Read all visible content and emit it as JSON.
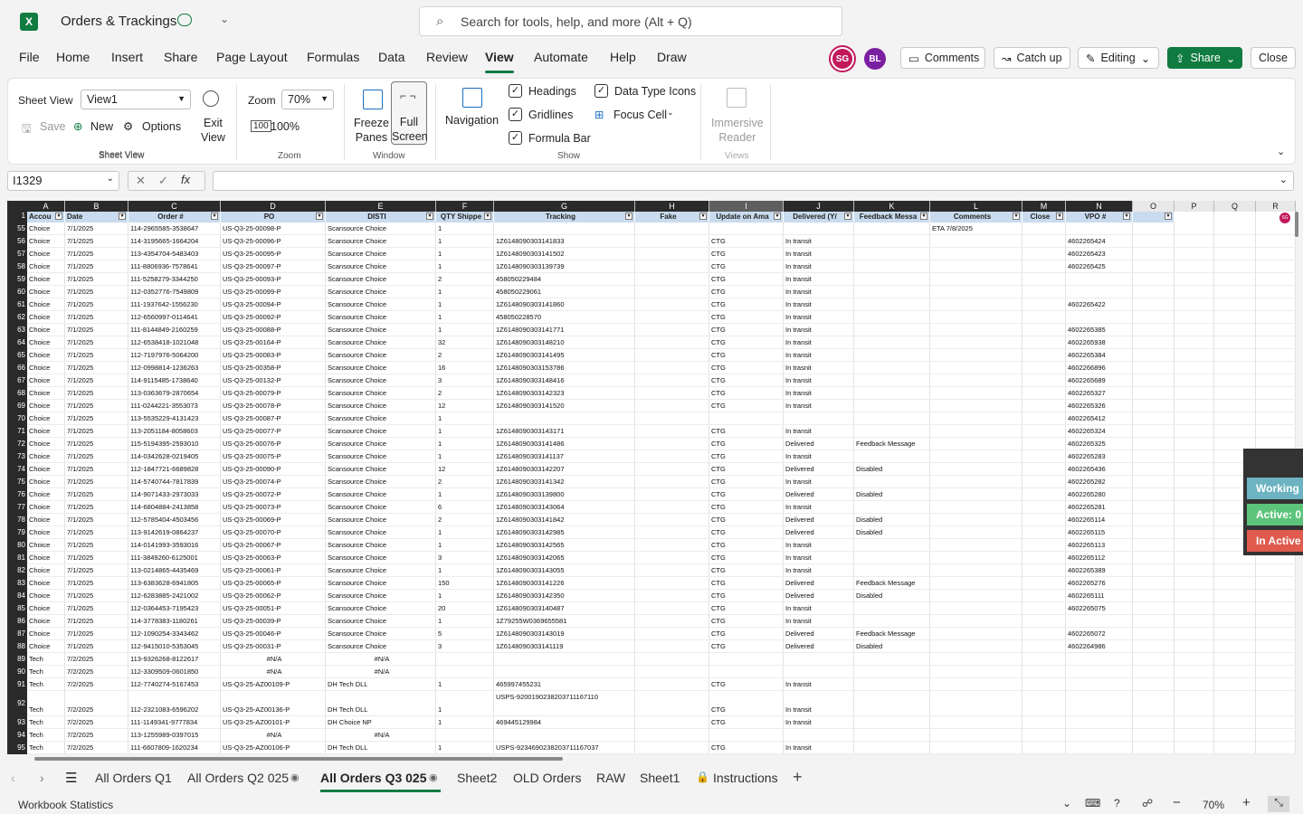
{
  "app": {
    "title": "Orders & Trackings",
    "search_placeholder": "Search for tools, help, and more (Alt + Q)"
  },
  "menu": [
    "File",
    "Home",
    "Insert",
    "Share",
    "Page Layout",
    "Formulas",
    "Data",
    "Review",
    "View",
    "Automate",
    "Help",
    "Draw"
  ],
  "menu_active": "View",
  "avatars": [
    {
      "initials": "SG",
      "color": "#c2185b"
    },
    {
      "initials": "BL",
      "color": "#7b1fa2"
    }
  ],
  "top_buttons": {
    "comments": "Comments",
    "catchup": "Catch up",
    "editing": "Editing",
    "share": "Share",
    "close": "Close"
  },
  "ribbon": {
    "sheet_view_label": "Sheet View",
    "sheet_view_value": "View1",
    "save": "Save",
    "new": "New",
    "options": "Options",
    "exit_view": "Exit\nView",
    "group_sheet_view": "Sheet View",
    "zoom_label": "Zoom",
    "zoom_value": "70%",
    "zoom_100": "100%",
    "group_zoom": "Zoom",
    "freeze": "Freeze\nPanes",
    "full": "Full\nScreen",
    "group_window": "Window",
    "navigation": "Navigation",
    "headings": "Headings",
    "gridlines": "Gridlines",
    "formula_bar": "Formula Bar",
    "data_type_icons": "Data Type Icons",
    "focus_cell": "Focus Cell",
    "group_show": "Show",
    "immersive": "Immersive\nReader",
    "group_views": "Views"
  },
  "formula_bar": {
    "name_box": "I1329",
    "fx": "fx",
    "value": ""
  },
  "columns": [
    {
      "letter": "A",
      "header": "Accou"
    },
    {
      "letter": "B",
      "header": "Date"
    },
    {
      "letter": "C",
      "header": "Order #"
    },
    {
      "letter": "D",
      "header": "PO"
    },
    {
      "letter": "E",
      "header": "DISTI"
    },
    {
      "letter": "F",
      "header": "QTY Shippe"
    },
    {
      "letter": "G",
      "header": "Tracking"
    },
    {
      "letter": "H",
      "header": "Fake"
    },
    {
      "letter": "I",
      "header": "Update on Ama"
    },
    {
      "letter": "J",
      "header": "Delivered (Y/"
    },
    {
      "letter": "K",
      "header": "Feedback Messa"
    },
    {
      "letter": "L",
      "header": "Comments"
    },
    {
      "letter": "M",
      "header": "Close"
    },
    {
      "letter": "N",
      "header": "VPO #"
    },
    {
      "letter": "O",
      "header": ""
    },
    {
      "letter": "P",
      "header": ""
    },
    {
      "letter": "Q",
      "header": ""
    },
    {
      "letter": "R",
      "header": ""
    }
  ],
  "rows": [
    {
      "n": "55",
      "c": [
        "Choice",
        "7/1/2025",
        "114-2965585-3538647",
        "US-Q3-25-00098-P",
        "Scansource Choice",
        "1",
        "",
        "",
        "",
        "",
        "",
        "ETA 7/8/2025",
        "",
        ""
      ]
    },
    {
      "n": "56",
      "c": [
        "Choice",
        "7/1/2025",
        "114-3195665-1664204",
        "US-Q3-25-00096-P",
        "Scansource Choice",
        "1",
        "1Z6148090303141833",
        "",
        "CTG",
        "In transit",
        "",
        "",
        "",
        "4602265424"
      ]
    },
    {
      "n": "57",
      "c": [
        "Choice",
        "7/1/2025",
        "113-4354704-5483403",
        "US-Q3-25-00095-P",
        "Scansource Choice",
        "1",
        "1Z6148090303141502",
        "",
        "CTG",
        "In transit",
        "",
        "",
        "",
        "4602265423"
      ]
    },
    {
      "n": "58",
      "c": [
        "Choice",
        "7/1/2025",
        "111-8806936-7578641",
        "US-Q3-25-00097-P",
        "Scansource Choice",
        "1",
        "1Z6148090303139739",
        "",
        "CTG",
        "In transit",
        "",
        "",
        "",
        "4602265425"
      ]
    },
    {
      "n": "59",
      "c": [
        "Choice",
        "7/1/2025",
        "111-5258279-3344250",
        "US-Q3-25-00093-P",
        "Scansource Choice",
        "2",
        "458050229484",
        "",
        "CTG",
        "In transit",
        "",
        "",
        "",
        ""
      ]
    },
    {
      "n": "60",
      "c": [
        "Choice",
        "7/1/2025",
        "112-0352776-7549809",
        "US-Q3-25-00099-P",
        "Scansource Choice",
        "1",
        "458050229061",
        "",
        "CTG",
        "In transit",
        "",
        "",
        "",
        ""
      ]
    },
    {
      "n": "61",
      "c": [
        "Choice",
        "7/1/2025",
        "111-1937642-1556230",
        "US-Q3-25-00094-P",
        "Scansource Choice",
        "1",
        "1Z6148090303141860",
        "",
        "CTG",
        "In transit",
        "",
        "",
        "",
        "4602265422"
      ]
    },
    {
      "n": "62",
      "c": [
        "Choice",
        "7/1/2025",
        "112-6560997-0114641",
        "US-Q3-25-00092-P",
        "Scansource Choice",
        "1",
        "458050228570",
        "",
        "CTG",
        "In transit",
        "",
        "",
        "",
        ""
      ]
    },
    {
      "n": "63",
      "c": [
        "Choice",
        "7/1/2025",
        "111-8144849-2160259",
        "US-Q3-25-00088-P",
        "Scansource Choice",
        "1",
        "1Z6148090303141771",
        "",
        "CTG",
        "In transit",
        "",
        "",
        "",
        "4602265385"
      ]
    },
    {
      "n": "64",
      "c": [
        "Choice",
        "7/1/2025",
        "112-6538418-1021048",
        "US-Q3-25-00164-P",
        "Scansource Choice",
        "32",
        "1Z6148090303148210",
        "",
        "CTG",
        "In transit",
        "",
        "",
        "",
        "4602265938"
      ]
    },
    {
      "n": "65",
      "c": [
        "Choice",
        "7/1/2025",
        "112-7197976-5064200",
        "US-Q3-25-00083-P",
        "Scansource Choice",
        "2",
        "1Z6148090303141495",
        "",
        "CTG",
        "In transit",
        "",
        "",
        "",
        "4602265384"
      ]
    },
    {
      "n": "66",
      "c": [
        "Choice",
        "7/1/2025",
        "112-0998814-1236263",
        "US-Q3-25-00358-P",
        "Scansource Choice",
        "16",
        "1Z6148090303153786",
        "",
        "CTG",
        "In trasnit",
        "",
        "",
        "",
        "4602266896"
      ]
    },
    {
      "n": "67",
      "c": [
        "Choice",
        "7/1/2025",
        "114-9115485-1738640",
        "US-Q3-25-00132-P",
        "Scansource Choice",
        "3",
        "1Z6148090303148416",
        "",
        "CTG",
        "In transit",
        "",
        "",
        "",
        "4602265689"
      ]
    },
    {
      "n": "68",
      "c": [
        "Choice",
        "7/1/2025",
        "113-0363679-2870654",
        "US-Q3-25-00079-P",
        "Scansource Choice",
        "2",
        "1Z6148090303142323",
        "",
        "CTG",
        "In transit",
        "",
        "",
        "",
        "4602265327"
      ]
    },
    {
      "n": "69",
      "c": [
        "Choice",
        "7/1/2025",
        "111-0244221-3553073",
        "US-Q3-25-00078-P",
        "Scansource Choice",
        "12",
        "1Z6148090303141520",
        "",
        "CTG",
        "In transit",
        "",
        "",
        "",
        "4602265326"
      ]
    },
    {
      "n": "70",
      "c": [
        "Choice",
        "7/1/2025",
        "113-5535229-4131423",
        "US-Q3-25-00087-P",
        "Scansource Choice",
        "1",
        "",
        "",
        "",
        "",
        "",
        "",
        "",
        "4602265412"
      ]
    },
    {
      "n": "71",
      "c": [
        "Choice",
        "7/1/2025",
        "113-2051184-8058603",
        "US-Q3-25-00077-P",
        "Scansource Choice",
        "1",
        "1Z6148090303143171",
        "",
        "CTG",
        "In transit",
        "",
        "",
        "",
        "4602265324"
      ]
    },
    {
      "n": "72",
      "c": [
        "Choice",
        "7/1/2025",
        "115-5194395-2593010",
        "US-Q3-25-00076-P",
        "Scansource Choice",
        "1",
        "1Z6148090303141486",
        "",
        "CTG",
        "Delivered",
        "Feedback Message",
        "",
        "",
        "4602265325"
      ]
    },
    {
      "n": "73",
      "c": [
        "Choice",
        "7/1/2025",
        "114-0342628-0219405",
        "US-Q3-25-00075-P",
        "Scansource Choice",
        "1",
        "1Z6148090303141137",
        "",
        "CTG",
        "In transit",
        "",
        "",
        "",
        "4602265283"
      ]
    },
    {
      "n": "74",
      "c": [
        "Choice",
        "7/1/2025",
        "112-1847721-6689828",
        "US-Q3-25-00090-P",
        "Scansource Choice",
        "12",
        "1Z6148090303142207",
        "",
        "CTG",
        "Delivered",
        "Disabled",
        "",
        "",
        "4602265436"
      ]
    },
    {
      "n": "75",
      "c": [
        "Choice",
        "7/1/2025",
        "114-5740744-7817839",
        "US-Q3-25-00074-P",
        "Scansource Choice",
        "2",
        "1Z6148090303141342",
        "",
        "CTG",
        "In transit",
        "",
        "",
        "",
        "4602265282"
      ]
    },
    {
      "n": "76",
      "c": [
        "Choice",
        "7/1/2025",
        "114-9071433-2973033",
        "US-Q3-25-00072-P",
        "Scansource Choice",
        "1",
        "1Z6148090303139800",
        "",
        "CTG",
        "Delivered",
        "Disabled",
        "",
        "",
        "4602265280"
      ]
    },
    {
      "n": "77",
      "c": [
        "Choice",
        "7/1/2025",
        "114-6804884-2413858",
        "US-Q3-25-00073-P",
        "Scansource Choice",
        "6",
        "1Z6148090303143064",
        "",
        "CTG",
        "In transit",
        "",
        "",
        "",
        "4602265281"
      ]
    },
    {
      "n": "78",
      "c": [
        "Choice",
        "7/1/2025",
        "112-5785404-4503456",
        "US-Q3-25-00069-P",
        "Scansource Choice",
        "2",
        "1Z6148090303141842",
        "",
        "CTG",
        "Delivered",
        "Disabled",
        "",
        "",
        "4602265114"
      ]
    },
    {
      "n": "79",
      "c": [
        "Choice",
        "7/1/2025",
        "113-9142619-0864237",
        "US-Q3-25-00070-P",
        "Scansource Choice",
        "1",
        "1Z6148090303142985",
        "",
        "CTG",
        "Delivered",
        "Disabled",
        "",
        "",
        "4602265115"
      ]
    },
    {
      "n": "80",
      "c": [
        "Choice",
        "7/1/2025",
        "114-0141993-3593016",
        "US-Q3-25-00067-P",
        "Scansource Choice",
        "1",
        "1Z6148090303142565",
        "",
        "CTG",
        "In transit",
        "",
        "",
        "",
        "4602265113"
      ]
    },
    {
      "n": "81",
      "c": [
        "Choice",
        "7/1/2025",
        "111-3849260-6125001",
        "US-Q3-25-00063-P",
        "Scansource Choice",
        "3",
        "1Z6148090303142065",
        "",
        "CTG",
        "In transit",
        "",
        "",
        "",
        "4602265112"
      ]
    },
    {
      "n": "82",
      "c": [
        "Choice",
        "7/1/2025",
        "113-0214865-4435469",
        "US-Q3-25-00061-P",
        "Scansource Choice",
        "1",
        "1Z6148090303143055",
        "",
        "CTG",
        "In transit",
        "",
        "",
        "",
        "4602265389"
      ]
    },
    {
      "n": "83",
      "c": [
        "Choice",
        "7/1/2025",
        "113-6383628-6941805",
        "US-Q3-25-00065-P",
        "Scansource Choice",
        "150",
        "1Z6148090303141226",
        "",
        "CTG",
        "Delivered",
        "Feedback Message",
        "",
        "",
        "4602265276"
      ]
    },
    {
      "n": "84",
      "c": [
        "Choice",
        "7/1/2025",
        "112-6283885-2421002",
        "US-Q3-25-00062-P",
        "Scansource Choice",
        "1",
        "1Z6148090303142350",
        "",
        "CTG",
        "Delivered",
        "Disabled",
        "",
        "",
        "4602265111"
      ]
    },
    {
      "n": "85",
      "c": [
        "Choice",
        "7/1/2025",
        "112-0364453-7195423",
        "US-Q3-25-00051-P",
        "Scansource Choice",
        "20",
        "1Z6148090303140487",
        "",
        "CTG",
        "In transit",
        "",
        "",
        "",
        "4602265075"
      ]
    },
    {
      "n": "86",
      "c": [
        "Choice",
        "7/1/2025",
        "114-3778383-1180261",
        "US-Q3-25-00039-P",
        "Scansource Choice",
        "1",
        "1Z79255W0369655581",
        "",
        "CTG",
        "In transit",
        "",
        "",
        "",
        ""
      ]
    },
    {
      "n": "87",
      "c": [
        "Choice",
        "7/1/2025",
        "112-1090254-3343462",
        "US-Q3-25-00046-P",
        "Scansource Choice",
        "5",
        "1Z6148090303143019",
        "",
        "CTG",
        "Delivered",
        "Feedback Message",
        "",
        "",
        "4602265072"
      ]
    },
    {
      "n": "88",
      "c": [
        "Choice",
        "7/1/2025",
        "112-9415010-5353045",
        "US-Q3-25-00031-P",
        "Scansource Choice",
        "3",
        "1Z6148090303141119",
        "",
        "CTG",
        "Delivered",
        "Disabled",
        "",
        "",
        "4602264986"
      ]
    },
    {
      "n": "89",
      "c": [
        "Tech",
        "7/2/2025",
        "113-9326268-8122617",
        "#N/A",
        "#N/A",
        "",
        "",
        "",
        "",
        "",
        "",
        "",
        "",
        ""
      ]
    },
    {
      "n": "90",
      "c": [
        "Tech",
        "7/2/2025",
        "112-3309509-0601850",
        "#N/A",
        "#N/A",
        "",
        "",
        "",
        "",
        "",
        "",
        "",
        "",
        ""
      ]
    },
    {
      "n": "91",
      "c": [
        "Tech",
        "7/2/2025",
        "112-7740274-5167453",
        "US-Q3-25-AZ00109-P",
        "DH Tech DLL",
        "1",
        "465997455231",
        "",
        "CTG",
        "In transit",
        "",
        "",
        "",
        ""
      ]
    },
    {
      "n": "92",
      "c": [
        "Tech",
        "7/2/2025",
        "112-2321083-6596202",
        "US-Q3-25-AZ00136-P",
        "DH Tech DLL",
        "1",
        "USPS-9200190238203711167110",
        "",
        "CTG",
        "In transit",
        "",
        "",
        "",
        ""
      ]
    },
    {
      "n": "93",
      "c": [
        "Tech",
        "7/2/2025",
        "111-1149341-9777834",
        "US-Q3-25-AZ00101-P",
        "DH Choice NP",
        "1",
        "469445129984",
        "",
        "CTG",
        "In transit",
        "",
        "",
        "",
        ""
      ]
    },
    {
      "n": "94",
      "c": [
        "Tech",
        "7/2/2025",
        "113-1255989-0397015",
        "#N/A",
        "#N/A",
        "",
        "",
        "",
        "",
        "",
        "",
        "",
        "",
        ""
      ]
    },
    {
      "n": "95",
      "c": [
        "Tech",
        "7/2/2025",
        "111-6607809-1620234",
        "US-Q3-25-AZ00106-P",
        "DH Tech DLL",
        "1",
        "USPS-9234690238203711167037",
        "",
        "CTG",
        "In transit",
        "",
        "",
        "",
        ""
      ]
    }
  ],
  "side_panel": {
    "working": "Working",
    "active": "Active: 0",
    "inactive": "In Active"
  },
  "tabs": [
    "All Orders Q1",
    "All Orders Q2 025",
    "All Orders Q3 025",
    "Sheet2",
    "OLD Orders",
    "RAW",
    "Sheet1",
    "Instructions"
  ],
  "tab_active": "All Orders Q3 025",
  "status": {
    "left": "Workbook Statistics",
    "zoom": "70%"
  }
}
